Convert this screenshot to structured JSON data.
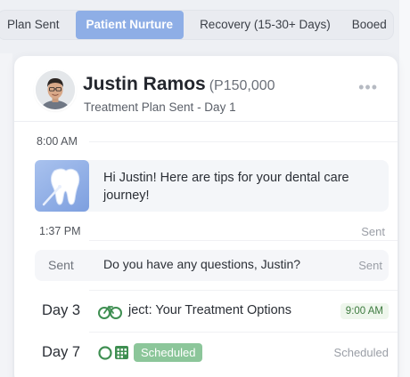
{
  "tabs": [
    {
      "label": "Plan Sent",
      "active": false
    },
    {
      "label": "Patient Nurture",
      "active": true
    },
    {
      "label": "Recovery (15-30+ Days)",
      "active": false
    },
    {
      "label": "Booed",
      "active": false
    }
  ],
  "patient": {
    "name": "Justin Ramos",
    "amount": "(P150,000",
    "subtitle": "Treatment Plan Sent - Day 1",
    "more_icon": "more-horizontal-icon"
  },
  "timeline": {
    "time_1": "8:00 AM",
    "message_1": {
      "icon": "tooth-icon",
      "text": "Hi Justin! Here are tips for your dental care journey!"
    },
    "time_2": "1:37 PM",
    "time_2_status": "Sent",
    "message_2": {
      "label": "Sent",
      "text": "Do you have any questions, Justin?",
      "status": "Sent"
    },
    "day_3": {
      "label": "Day 3",
      "icon": "bicycle-icon",
      "text": "ject: Your Treatment Options",
      "time": "9:00 AM"
    },
    "day_7": {
      "label": "Day 7",
      "icons": [
        "cycle-icon",
        "calendar-grid-icon"
      ],
      "badge": "Scheduled",
      "status": "Scheduled"
    }
  },
  "colors": {
    "active_tab": "#8eaee6",
    "scheduled_badge": "#8cc69a",
    "time_badge_text": "#3d7a3f"
  }
}
